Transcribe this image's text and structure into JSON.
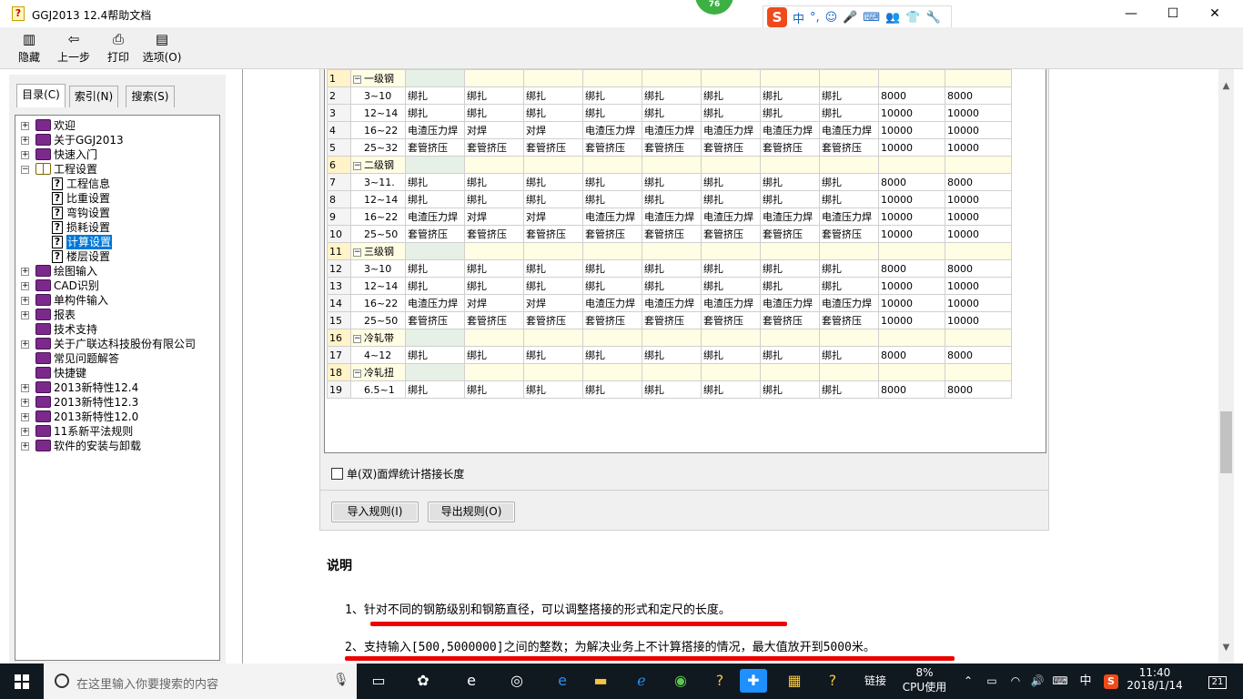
{
  "window": {
    "title": "GGJ2013 12.4帮助文档",
    "badge": "76"
  },
  "ime": {
    "logo": "S",
    "items": [
      "中",
      "°,",
      "☺",
      "🎤",
      "⌨",
      "👥",
      "👕",
      "🔧"
    ]
  },
  "toolbar": {
    "hide": "隐藏",
    "back": "上一步",
    "print": "打印",
    "options": "选项(O)"
  },
  "tabs": {
    "contents": "目录(C)",
    "index": "索引(N)",
    "search": "搜索(S)"
  },
  "tree": [
    {
      "label": "欢迎",
      "level": 0,
      "type": "book",
      "expander": "+"
    },
    {
      "label": "关于GGJ2013",
      "level": 0,
      "type": "book",
      "expander": "+"
    },
    {
      "label": "快速入门",
      "level": 0,
      "type": "book",
      "expander": "+"
    },
    {
      "label": "工程设置",
      "level": 0,
      "type": "open",
      "expander": "−"
    },
    {
      "label": "工程信息",
      "level": 1,
      "type": "page"
    },
    {
      "label": "比重设置",
      "level": 1,
      "type": "page"
    },
    {
      "label": "弯钩设置",
      "level": 1,
      "type": "page"
    },
    {
      "label": "损耗设置",
      "level": 1,
      "type": "page"
    },
    {
      "label": "计算设置",
      "level": 1,
      "type": "page",
      "selected": true
    },
    {
      "label": "楼层设置",
      "level": 1,
      "type": "page"
    },
    {
      "label": "绘图输入",
      "level": 0,
      "type": "book",
      "expander": "+"
    },
    {
      "label": "CAD识别",
      "level": 0,
      "type": "book",
      "expander": "+"
    },
    {
      "label": "单构件输入",
      "level": 0,
      "type": "book",
      "expander": "+"
    },
    {
      "label": "报表",
      "level": 0,
      "type": "book",
      "expander": "+"
    },
    {
      "label": "技术支持",
      "level": 0,
      "type": "book"
    },
    {
      "label": "关于广联达科技股份有限公司",
      "level": 0,
      "type": "book",
      "expander": "+"
    },
    {
      "label": "常见问题解答",
      "level": 0,
      "type": "book"
    },
    {
      "label": "快捷键",
      "level": 0,
      "type": "book"
    },
    {
      "label": "2013新特性12.4",
      "level": 0,
      "type": "book",
      "expander": "+"
    },
    {
      "label": "2013新特性12.3",
      "level": 0,
      "type": "book",
      "expander": "+"
    },
    {
      "label": "2013新特性12.0",
      "level": 0,
      "type": "book",
      "expander": "+"
    },
    {
      "label": "11系新平法规则",
      "level": 0,
      "type": "book",
      "expander": "+"
    },
    {
      "label": "软件的安装与卸载",
      "level": 0,
      "type": "book",
      "expander": "+"
    }
  ],
  "rules_table": [
    {
      "n": "1",
      "group": "一级钢"
    },
    {
      "n": "2",
      "dia": "3~10",
      "cells": [
        "绑扎",
        "绑扎",
        "绑扎",
        "绑扎",
        "绑扎",
        "绑扎",
        "绑扎",
        "绑扎",
        "8000",
        "8000"
      ]
    },
    {
      "n": "3",
      "dia": "12~14",
      "cells": [
        "绑扎",
        "绑扎",
        "绑扎",
        "绑扎",
        "绑扎",
        "绑扎",
        "绑扎",
        "绑扎",
        "10000",
        "10000"
      ]
    },
    {
      "n": "4",
      "dia": "16~22",
      "cells": [
        "电渣压力焊",
        "对焊",
        "对焊",
        "电渣压力焊",
        "电渣压力焊",
        "电渣压力焊",
        "电渣压力焊",
        "电渣压力焊",
        "10000",
        "10000"
      ]
    },
    {
      "n": "5",
      "dia": "25~32",
      "cells": [
        "套管挤压",
        "套管挤压",
        "套管挤压",
        "套管挤压",
        "套管挤压",
        "套管挤压",
        "套管挤压",
        "套管挤压",
        "10000",
        "10000"
      ]
    },
    {
      "n": "6",
      "group": "二级钢"
    },
    {
      "n": "7",
      "dia": "3~11.",
      "cells": [
        "绑扎",
        "绑扎",
        "绑扎",
        "绑扎",
        "绑扎",
        "绑扎",
        "绑扎",
        "绑扎",
        "8000",
        "8000"
      ]
    },
    {
      "n": "8",
      "dia": "12~14",
      "cells": [
        "绑扎",
        "绑扎",
        "绑扎",
        "绑扎",
        "绑扎",
        "绑扎",
        "绑扎",
        "绑扎",
        "10000",
        "10000"
      ]
    },
    {
      "n": "9",
      "dia": "16~22",
      "cells": [
        "电渣压力焊",
        "对焊",
        "对焊",
        "电渣压力焊",
        "电渣压力焊",
        "电渣压力焊",
        "电渣压力焊",
        "电渣压力焊",
        "10000",
        "10000"
      ]
    },
    {
      "n": "10",
      "dia": "25~50",
      "cells": [
        "套管挤压",
        "套管挤压",
        "套管挤压",
        "套管挤压",
        "套管挤压",
        "套管挤压",
        "套管挤压",
        "套管挤压",
        "10000",
        "10000"
      ]
    },
    {
      "n": "11",
      "group": "三级钢"
    },
    {
      "n": "12",
      "dia": "3~10",
      "cells": [
        "绑扎",
        "绑扎",
        "绑扎",
        "绑扎",
        "绑扎",
        "绑扎",
        "绑扎",
        "绑扎",
        "8000",
        "8000"
      ]
    },
    {
      "n": "13",
      "dia": "12~14",
      "cells": [
        "绑扎",
        "绑扎",
        "绑扎",
        "绑扎",
        "绑扎",
        "绑扎",
        "绑扎",
        "绑扎",
        "10000",
        "10000"
      ]
    },
    {
      "n": "14",
      "dia": "16~22",
      "cells": [
        "电渣压力焊",
        "对焊",
        "对焊",
        "电渣压力焊",
        "电渣压力焊",
        "电渣压力焊",
        "电渣压力焊",
        "电渣压力焊",
        "10000",
        "10000"
      ]
    },
    {
      "n": "15",
      "dia": "25~50",
      "cells": [
        "套管挤压",
        "套管挤压",
        "套管挤压",
        "套管挤压",
        "套管挤压",
        "套管挤压",
        "套管挤压",
        "套管挤压",
        "10000",
        "10000"
      ]
    },
    {
      "n": "16",
      "group": "冷轧带"
    },
    {
      "n": "17",
      "dia": "4~12",
      "cells": [
        "绑扎",
        "绑扎",
        "绑扎",
        "绑扎",
        "绑扎",
        "绑扎",
        "绑扎",
        "绑扎",
        "8000",
        "8000"
      ]
    },
    {
      "n": "18",
      "group": "冷轧扭"
    },
    {
      "n": "19",
      "dia": "6.5~1",
      "cells": [
        "绑扎",
        "绑扎",
        "绑扎",
        "绑扎",
        "绑扎",
        "绑扎",
        "绑扎",
        "绑扎",
        "8000",
        "8000"
      ]
    }
  ],
  "dialog": {
    "checkbox_label": "单(双)面焊统计搭接长度",
    "import_button": "导入规则(I)",
    "export_button": "导出规则(O)"
  },
  "description": {
    "title": "说明",
    "item1": "1、针对不同的钢筋级别和钢筋直径，可以调整搭接的形式和定尺的长度。",
    "item2": "2、支持输入[500,5000000]之间的整数；为解决业务上不计算搭接的情况，最大值放开到5000米。"
  },
  "taskbar": {
    "search_placeholder": "在这里输入你要搜索的内容",
    "tray_link": "链接",
    "cpu_percent": "8%",
    "cpu_label": "CPU使用",
    "ime_lang": "中",
    "time": "11:40",
    "date": "2018/1/14",
    "notifications": "21"
  },
  "colors": {
    "selection": "#0078d7",
    "underline": "#ee0000",
    "taskbar": "#101820"
  }
}
